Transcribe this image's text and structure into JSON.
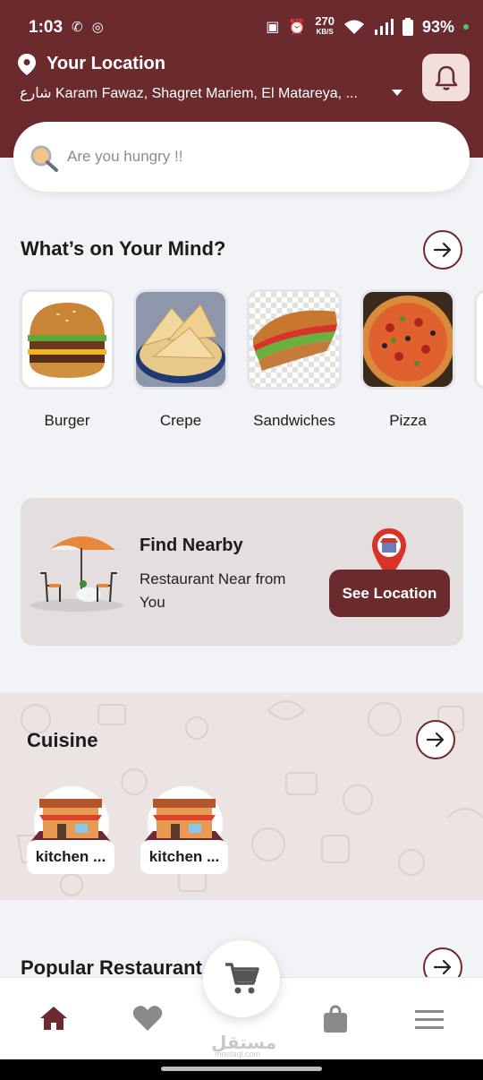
{
  "status_bar": {
    "time": "1:03",
    "network_speed": "270",
    "network_unit": "KB/S",
    "battery": "93%"
  },
  "header": {
    "location_title": "Your Location",
    "address": "شارع Karam Fawaz, Shagret Mariem, El Matareya, ..."
  },
  "search": {
    "placeholder": "Are you hungry !!"
  },
  "mind_section": {
    "title": "What’s on Your Mind?",
    "categories": [
      {
        "label": "Burger"
      },
      {
        "label": "Crepe"
      },
      {
        "label": "Sandwiches"
      },
      {
        "label": "Pizza"
      }
    ]
  },
  "nearby": {
    "title": "Find Nearby",
    "subtitle": "Restaurant Near from You",
    "button_label": "See Location"
  },
  "cuisine": {
    "title": "Cuisine",
    "items": [
      {
        "label": "kitchen ..."
      },
      {
        "label": "kitchen ..."
      }
    ]
  },
  "popular": {
    "title": "Popular Restaurant"
  },
  "bottom_nav": {
    "items": [
      "home-icon",
      "heart-icon",
      "bag-icon",
      "menu-icon"
    ],
    "active": "home-icon"
  },
  "watermark": {
    "text": "مستقل",
    "sub": "mostaql.com"
  },
  "colors": {
    "brand": "#6b2a2d",
    "background": "#f2f3f7",
    "accent_orange": "#e8873a"
  }
}
